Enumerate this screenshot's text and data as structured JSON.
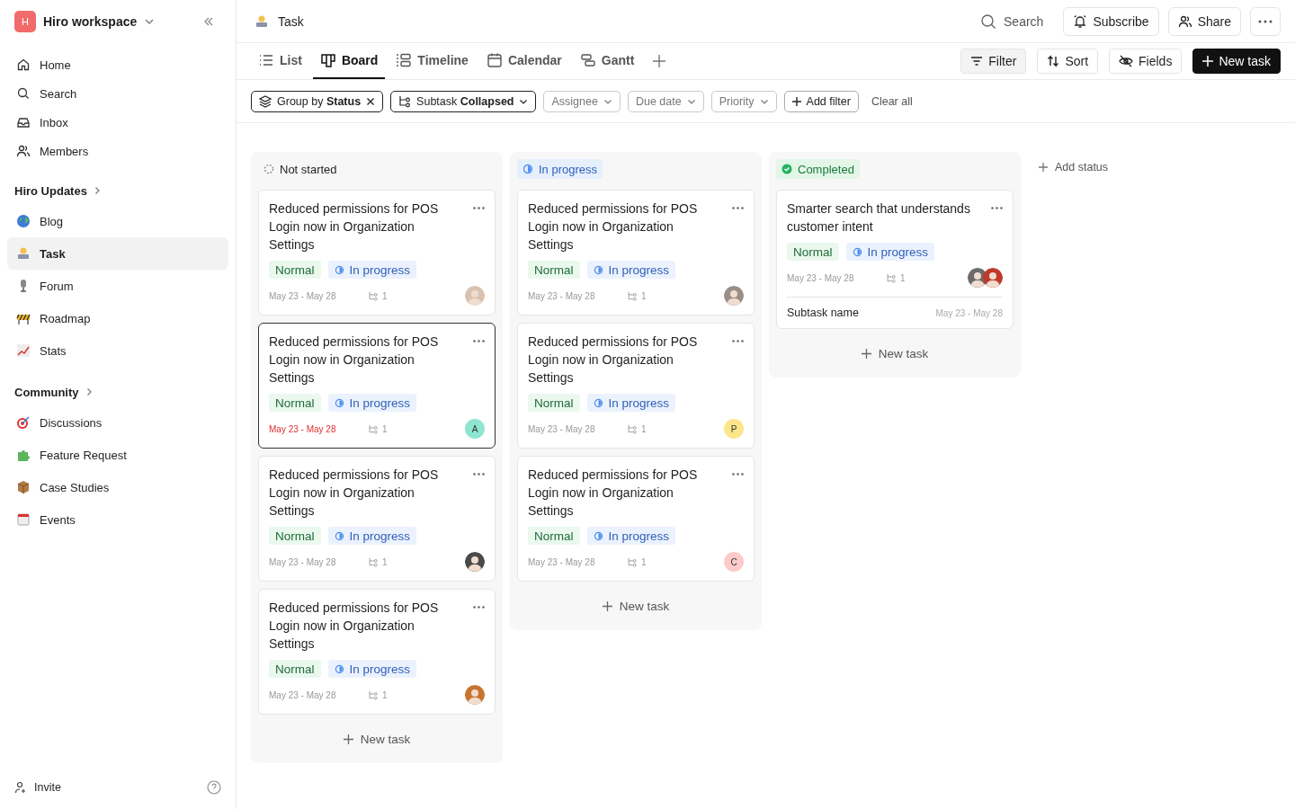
{
  "workspace": {
    "initial": "H",
    "name": "Hiro workspace"
  },
  "nav": [
    {
      "label": "Home"
    },
    {
      "label": "Search"
    },
    {
      "label": "Inbox"
    },
    {
      "label": "Members"
    }
  ],
  "sections": [
    {
      "title": "Hiro Updates",
      "items": [
        {
          "label": "Blog",
          "selected": false
        },
        {
          "label": "Task",
          "selected": true
        },
        {
          "label": "Forum",
          "selected": false
        },
        {
          "label": "Roadmap",
          "selected": false
        },
        {
          "label": "Stats",
          "selected": false
        }
      ]
    },
    {
      "title": "Community",
      "items": [
        {
          "label": "Discussions",
          "selected": false
        },
        {
          "label": "Feature Request",
          "selected": false
        },
        {
          "label": "Case Studies",
          "selected": false
        },
        {
          "label": "Events",
          "selected": false
        }
      ]
    }
  ],
  "invite": "Invite",
  "page_title": "Task",
  "header_actions": {
    "search": "Search",
    "subscribe": "Subscribe",
    "share": "Share"
  },
  "tabs": [
    {
      "label": "List",
      "selected": false
    },
    {
      "label": "Board",
      "selected": true
    },
    {
      "label": "Timeline",
      "selected": false
    },
    {
      "label": "Calendar",
      "selected": false
    },
    {
      "label": "Gantt",
      "selected": false
    }
  ],
  "toolbar": [
    {
      "label": "Filter",
      "kind": "filter",
      "selected": true
    },
    {
      "label": "Sort",
      "kind": "sort",
      "selected": false
    },
    {
      "label": "Fields",
      "kind": "fields",
      "selected": false
    },
    {
      "label": "New task",
      "kind": "primary"
    }
  ],
  "filters": [
    {
      "label": "Group by **Status**",
      "kind": "group",
      "active": true
    },
    {
      "label": "Subtask **Collapsed**",
      "kind": "subtask",
      "active": true
    },
    {
      "label": "Assignee",
      "kind": "plain",
      "active": false
    },
    {
      "label": "Due date",
      "kind": "plain",
      "active": false
    },
    {
      "label": "Priority",
      "kind": "plain",
      "active": false
    }
  ],
  "add_filter": "Add filter",
  "clear_all": "Clear all",
  "columns": [
    {
      "name": "Not started",
      "kind": "not_started",
      "new_task": "New task",
      "cards": [
        {
          "title": "Reduced permissions for POS Login now in Organization Settings",
          "priority": "Normal",
          "status": "In progress",
          "dates": "May 23 - May 28",
          "subtasks": "1",
          "overdue": false,
          "selected": false,
          "avatars": [
            {
              "kind": "photo",
              "color": "#d9c2b0"
            }
          ]
        },
        {
          "title": "Reduced permissions for POS Login now in Organization Settings",
          "priority": "Normal",
          "status": "In progress",
          "dates": "May 23 - May 28",
          "subtasks": "1",
          "overdue": true,
          "selected": true,
          "avatars": [
            {
              "kind": "letter",
              "letter": "A",
              "color": "#8ee6d2"
            }
          ]
        },
        {
          "title": "Reduced permissions for POS Login now in Organization Settings",
          "priority": "Normal",
          "status": "In progress",
          "dates": "May 23 - May 28",
          "subtasks": "1",
          "overdue": false,
          "selected": false,
          "avatars": [
            {
              "kind": "photo",
              "color": "#4a4a4a"
            }
          ]
        },
        {
          "title": "Reduced permissions for POS Login now in Organization Settings",
          "priority": "Normal",
          "status": "In progress",
          "dates": "May 23 - May 28",
          "subtasks": "1",
          "overdue": false,
          "selected": false,
          "avatars": [
            {
              "kind": "photo",
              "color": "#c8742e"
            }
          ]
        }
      ]
    },
    {
      "name": "In progress",
      "kind": "in_progress",
      "new_task": "New task",
      "cards": [
        {
          "title": "Reduced permissions for POS Login now in Organization Settings",
          "priority": "Normal",
          "status": "In progress",
          "dates": "May 23 - May 28",
          "subtasks": "1",
          "overdue": false,
          "selected": false,
          "avatars": [
            {
              "kind": "photo",
              "color": "#9a8f86"
            }
          ]
        },
        {
          "title": "Reduced permissions for POS Login now in Organization Settings",
          "priority": "Normal",
          "status": "In progress",
          "dates": "May 23 - May 28",
          "subtasks": "1",
          "overdue": false,
          "selected": false,
          "avatars": [
            {
              "kind": "letter",
              "letter": "P",
              "color": "#fde68a"
            }
          ]
        },
        {
          "title": "Reduced permissions for POS Login now in Organization Settings",
          "priority": "Normal",
          "status": "In progress",
          "dates": "May 23 - May 28",
          "subtasks": "1",
          "overdue": false,
          "selected": false,
          "avatars": [
            {
              "kind": "letter",
              "letter": "C",
              "color": "#fecaca"
            }
          ]
        }
      ]
    },
    {
      "name": "Completed",
      "kind": "completed",
      "new_task": "New task",
      "cards": [
        {
          "title": "Smarter search that understands customer intent",
          "priority": "Normal",
          "status": "In progress",
          "dates": "May 23 - May 28",
          "subtasks": "1",
          "overdue": false,
          "selected": false,
          "avatars": [
            {
              "kind": "photo",
              "color": "#6b6b6b"
            },
            {
              "kind": "photo",
              "color": "#c0392b"
            }
          ],
          "subtask": {
            "name": "Subtask name",
            "dates": "May 23 - May 28"
          }
        }
      ]
    }
  ],
  "add_status": "Add status"
}
